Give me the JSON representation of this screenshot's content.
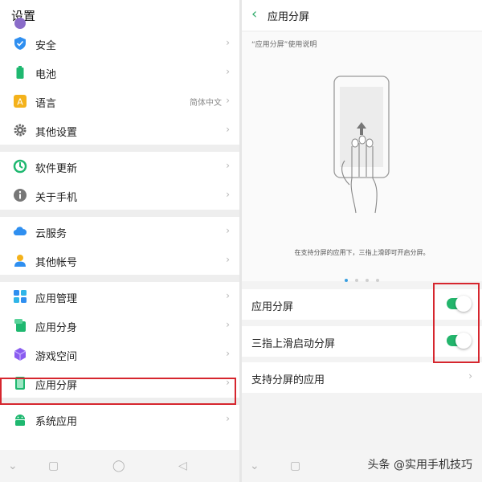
{
  "left": {
    "title": "设置",
    "groups": [
      {
        "items": [
          {
            "id": "security",
            "label": "安全",
            "icon": "shield-icon",
            "color": "#2f8ff0",
            "value": ""
          },
          {
            "id": "battery",
            "label": "电池",
            "icon": "battery-icon",
            "color": "#1fb870",
            "value": ""
          },
          {
            "id": "language",
            "label": "语言",
            "icon": "language-icon",
            "color": "#f4b21b",
            "value": "简体中文"
          },
          {
            "id": "other-settings",
            "label": "其他设置",
            "icon": "gear-icon",
            "color": "#666666",
            "value": ""
          }
        ]
      },
      {
        "items": [
          {
            "id": "software-update",
            "label": "软件更新",
            "icon": "update-icon",
            "color": "#1fb870",
            "value": ""
          },
          {
            "id": "about-phone",
            "label": "关于手机",
            "icon": "info-icon",
            "color": "#777777",
            "value": ""
          }
        ]
      },
      {
        "items": [
          {
            "id": "cloud-service",
            "label": "云服务",
            "icon": "cloud-icon",
            "color": "#2f8ff0",
            "value": ""
          },
          {
            "id": "other-accounts",
            "label": "其他帐号",
            "icon": "person-icon",
            "color": "#2f8ff0",
            "value": ""
          }
        ]
      },
      {
        "items": [
          {
            "id": "app-management",
            "label": "应用管理",
            "icon": "grid-icon",
            "color": "#2f8ff0",
            "value": ""
          },
          {
            "id": "app-clone",
            "label": "应用分身",
            "icon": "clone-icon",
            "color": "#1fb870",
            "value": ""
          },
          {
            "id": "game-space",
            "label": "游戏空间",
            "icon": "cube-icon",
            "color": "#8a5cf0",
            "value": ""
          },
          {
            "id": "split-screen",
            "label": "应用分屏",
            "icon": "split-screen-icon",
            "color": "#1fb870",
            "value": ""
          }
        ]
      },
      {
        "items": [
          {
            "id": "system-apps",
            "label": "系统应用",
            "icon": "android-icon",
            "color": "#1fb870",
            "value": ""
          }
        ]
      }
    ],
    "chevron": "›",
    "nav": {
      "back": "⌄",
      "home": "◯",
      "recents": "◁",
      "square": "▢"
    }
  },
  "right": {
    "back": "‹",
    "title": "应用分屏",
    "caption_top": "“应用分屏”使用说明",
    "caption_bottom": "在支持分屏的应用下，三指上滑即可开启分屏。",
    "dots": 4,
    "active_dot": 0,
    "settings": [
      {
        "label": "应用分屏",
        "type": "toggle",
        "on": true
      },
      {
        "label": "三指上滑启动分屏",
        "type": "toggle",
        "on": true
      },
      {
        "label": "支持分屏的应用",
        "type": "link"
      }
    ],
    "chevron": "›",
    "toggle_color": "#23b56c"
  },
  "watermark": "头条 @实用手机技巧"
}
